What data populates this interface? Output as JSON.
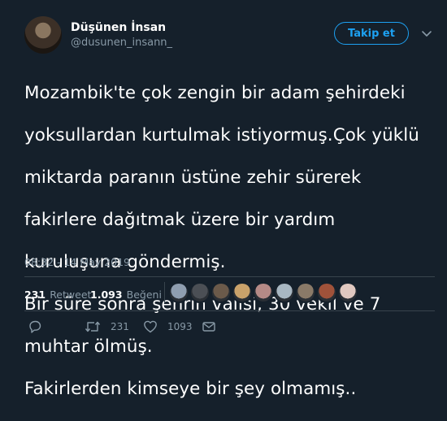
{
  "author": {
    "display_name": "Düşünen İnsan",
    "handle": "@dusunen_insann_"
  },
  "follow_label": "Takip et",
  "tweet": {
    "lines": [
      "Mozambik'te çok zengin bir adam şehirdeki",
      "yoksullardan kurtulmak istiyormuş.Çok yüklü",
      "miktarda paranın üstüne zehir sürerek",
      "fakirlere dağıtmak üzere bir yardım",
      "kuruluşuna göndermiş.",
      "Bir süre sonra şehrin valisi, 30 vekil ve 7",
      "muhtar ölmüş.",
      "Fakirlerden kimseye bir şey olmamış.."
    ],
    "timestamp": "08:32 - 14 May 2019"
  },
  "stats": {
    "retweet_count": "231",
    "retweet_label": "Retweet",
    "like_count": "1.093",
    "like_label": "Beğeni"
  },
  "liker_avatar_colors": [
    "#8f9eb0",
    "#4b4f55",
    "#6b5a4a",
    "#c9a26a",
    "#b58a86",
    "#a8b7c2",
    "#8a7a68",
    "#a0523a",
    "#e0c8c0"
  ],
  "actions": {
    "reply_count": "",
    "retweet_count": "231",
    "like_count": "1093"
  },
  "colors": {
    "background": "#15202b",
    "accent": "#1da1f2",
    "muted": "#8899a6",
    "divider": "#38444d"
  }
}
